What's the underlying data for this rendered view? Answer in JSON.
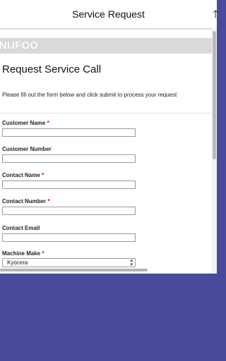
{
  "navbar": {
    "title": "Service Request",
    "back_icon": "back-arrow-icon"
  },
  "brand": {
    "logo_text": "NUFOO"
  },
  "form": {
    "title": "Request Service Call",
    "description": "Please fill out the form below and click submit to process your request",
    "required_mark": "*",
    "fields": [
      {
        "label": "Customer Name",
        "required": true
      },
      {
        "label": "Customer Number",
        "required": false
      },
      {
        "label": "Contact Name",
        "required": true
      },
      {
        "label": "Contact Number",
        "required": true
      },
      {
        "label": "Contact Email",
        "required": false
      }
    ],
    "machine_make": {
      "label": "Machine Make",
      "required": true,
      "selected": "Kyocera"
    }
  }
}
